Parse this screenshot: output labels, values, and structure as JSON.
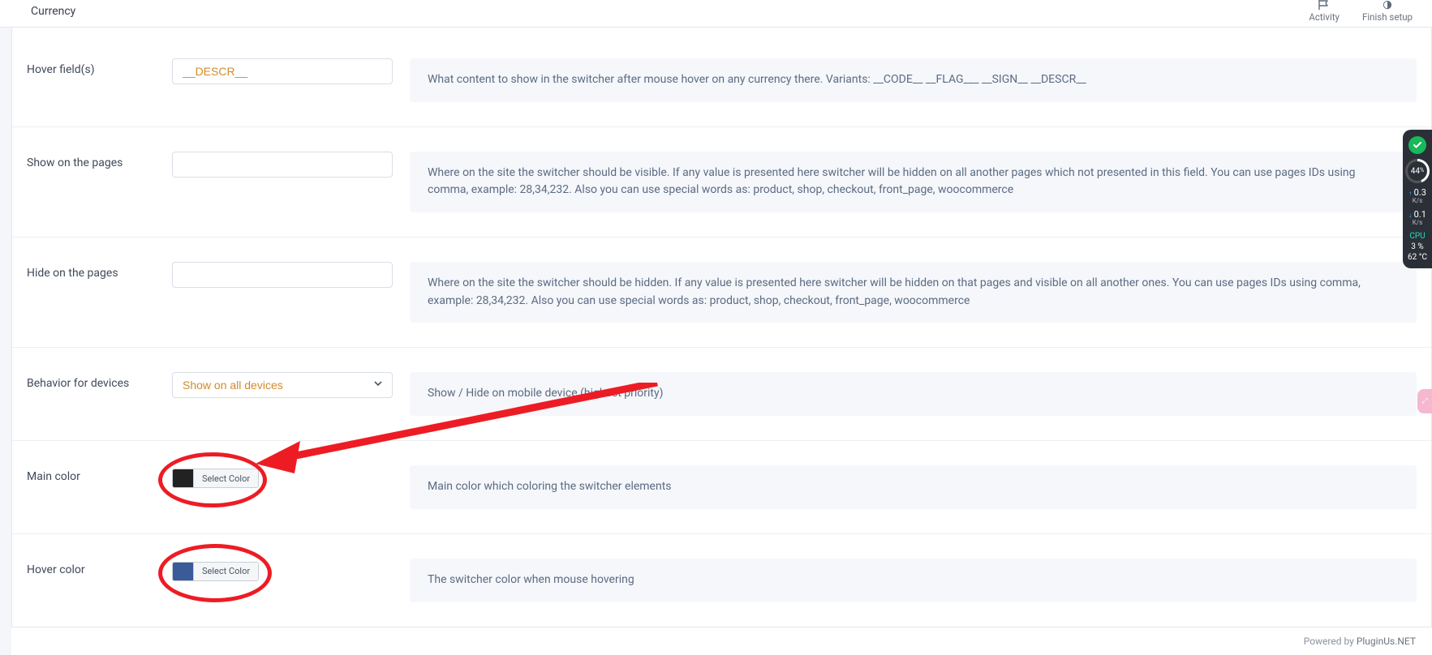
{
  "topbar": {
    "brand": "Currency",
    "activity": "Activity",
    "finish_setup": "Finish setup"
  },
  "rows": {
    "hover_fields": {
      "label": "Hover field(s)",
      "value": "__DESCR__",
      "help": "What content to show in the switcher after mouse hover on any currency there. Variants: __CODE__ __FLAG___ __SIGN__ __DESCR__"
    },
    "show_pages": {
      "label": "Show on the pages",
      "value": "",
      "help": "Where on the site the switcher should be visible. If any value is presented here switcher will be hidden on all another pages which not presented in this field. You can use pages IDs using comma, example: 28,34,232. Also you can use special words as: product, shop, checkout, front_page, woocommerce"
    },
    "hide_pages": {
      "label": "Hide on the pages",
      "value": "",
      "help": "Where on the site the switcher should be hidden. If any value is presented here switcher will be hidden on that pages and visible on all another ones. You can use pages IDs using comma, example: 28,34,232. Also you can use special words as: product, shop, checkout, front_page, woocommerce"
    },
    "behavior_devices": {
      "label": "Behavior for devices",
      "value": "Show on all devices",
      "help": "Show / Hide on mobile device (highest priority)"
    },
    "main_color": {
      "label": "Main color",
      "button": "Select Color",
      "swatch": "#222222",
      "help": "Main color which coloring the switcher elements"
    },
    "hover_color": {
      "label": "Hover color",
      "button": "Select Color",
      "swatch": "#3a5a9a",
      "help": "The switcher color when mouse hovering"
    }
  },
  "footer": {
    "text": "Powered by ",
    "link": "PluginUs.NET"
  },
  "sysmon": {
    "gauge": "44",
    "gauge_pct": "%",
    "up_val": "0.3",
    "up_unit": "K/s",
    "dn_val": "0.1",
    "dn_unit": "K/s",
    "cpu_label": "CPU",
    "cpu_pct": "3  %",
    "temp": "62  °C"
  },
  "pinkpill": "⤢"
}
